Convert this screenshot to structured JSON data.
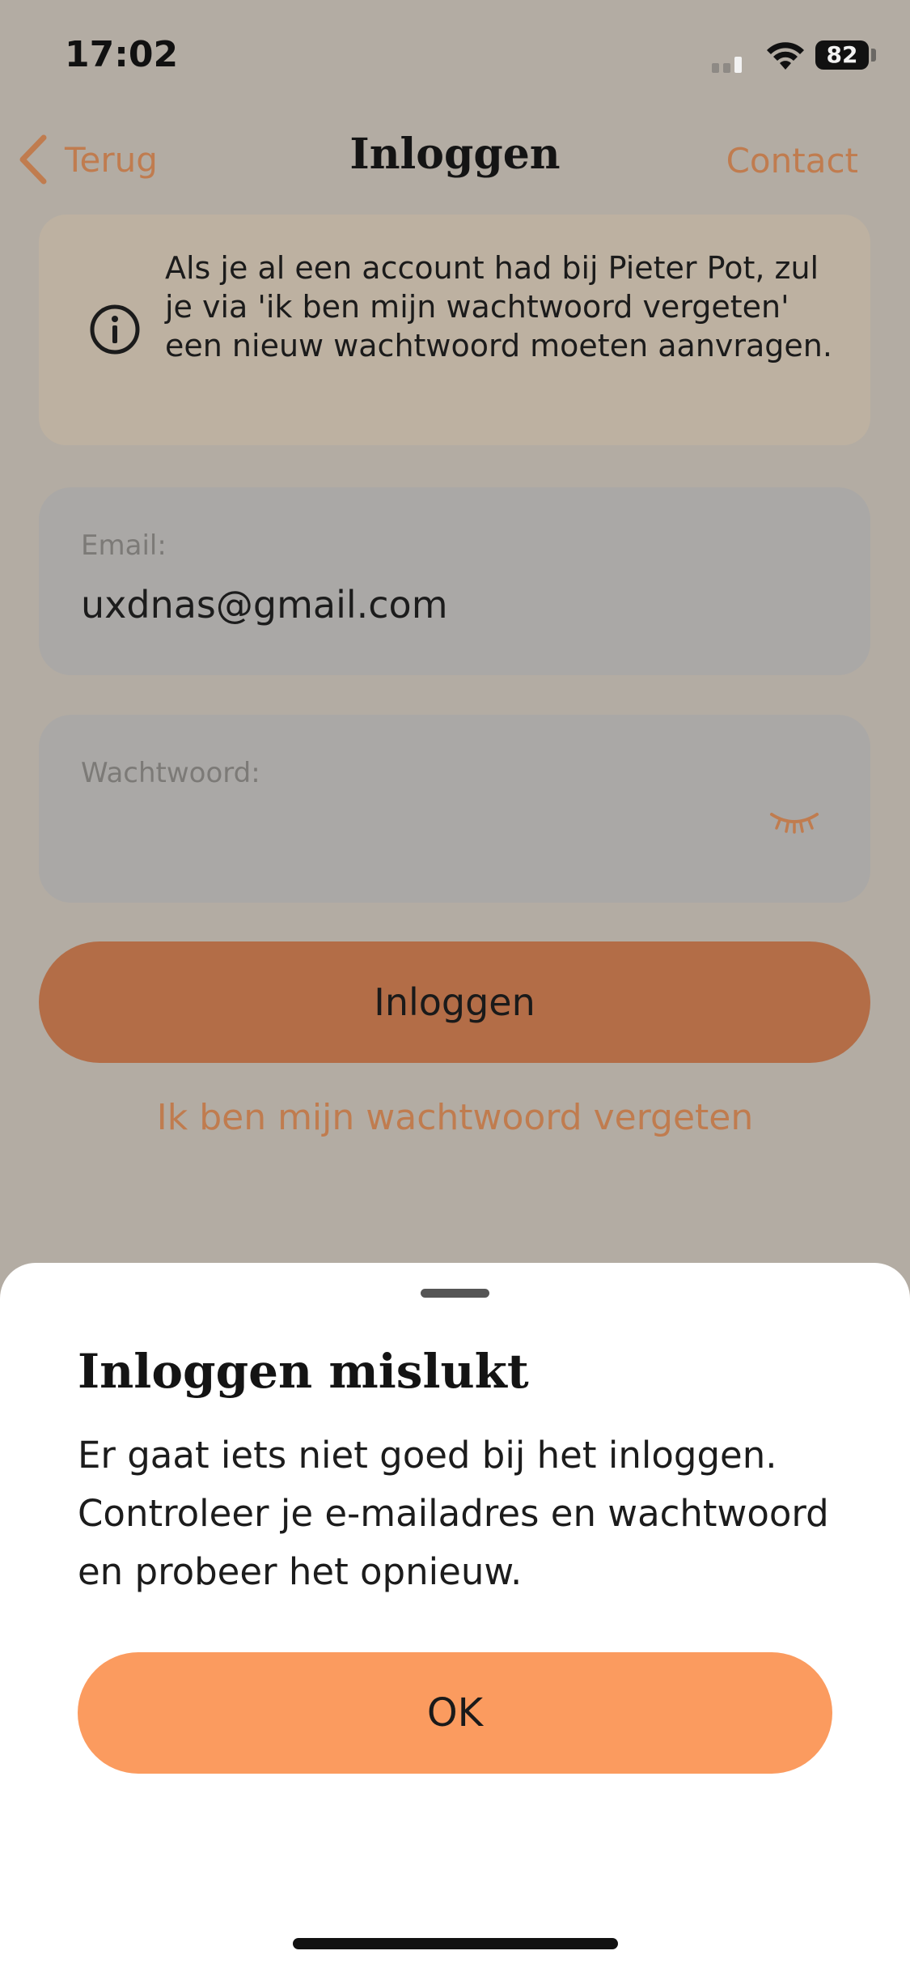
{
  "status_bar": {
    "time": "17:02",
    "battery": "82"
  },
  "nav": {
    "back_label": "Terug",
    "title": "Inloggen",
    "contact_label": "Contact"
  },
  "info_banner": {
    "icon": "info-icon",
    "text": "Als je al een account had bij Pieter Pot, zul je via 'ik ben mijn wachtwoord vergeten' een nieuw wachtwoord moeten aanvragen."
  },
  "form": {
    "email_label": "Email:",
    "email_value": "uxdnas@gmail.com",
    "password_label": "Wachtwoord:",
    "password_value": "",
    "login_button": "Inloggen",
    "forgot_link": "Ik ben mijn wachtwoord vergeten"
  },
  "sheet": {
    "title": "Inloggen mislukt",
    "message": "Er gaat iets niet goed bij het inloggen. Controleer je e-mailadres en wachtwoord en probeer het opnieuw.",
    "ok_button": "OK"
  },
  "colors": {
    "accent": "#c07c4f",
    "primary_button": "#fb9b5f",
    "dimmed_button": "#b36d47"
  }
}
